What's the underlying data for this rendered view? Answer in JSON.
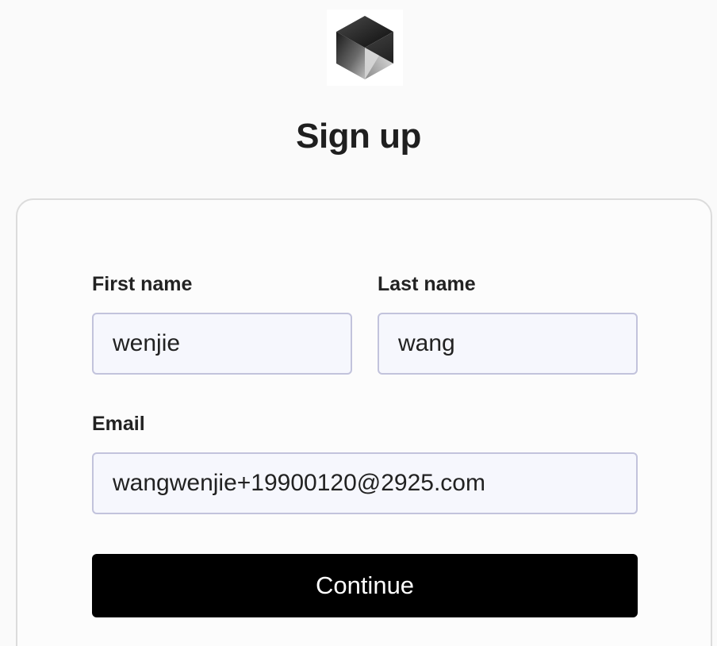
{
  "header": {
    "logo_icon": "cube-logo-icon",
    "title": "Sign up"
  },
  "form": {
    "first_name": {
      "label": "First name",
      "value": "wenjie"
    },
    "last_name": {
      "label": "Last name",
      "value": "wang"
    },
    "email": {
      "label": "Email",
      "value": "wangwenjie+19900120@2925.com"
    },
    "continue_label": "Continue"
  },
  "colors": {
    "button_bg": "#000000",
    "input_bg": "#f6f7fd",
    "input_border": "#c2c3dc"
  }
}
